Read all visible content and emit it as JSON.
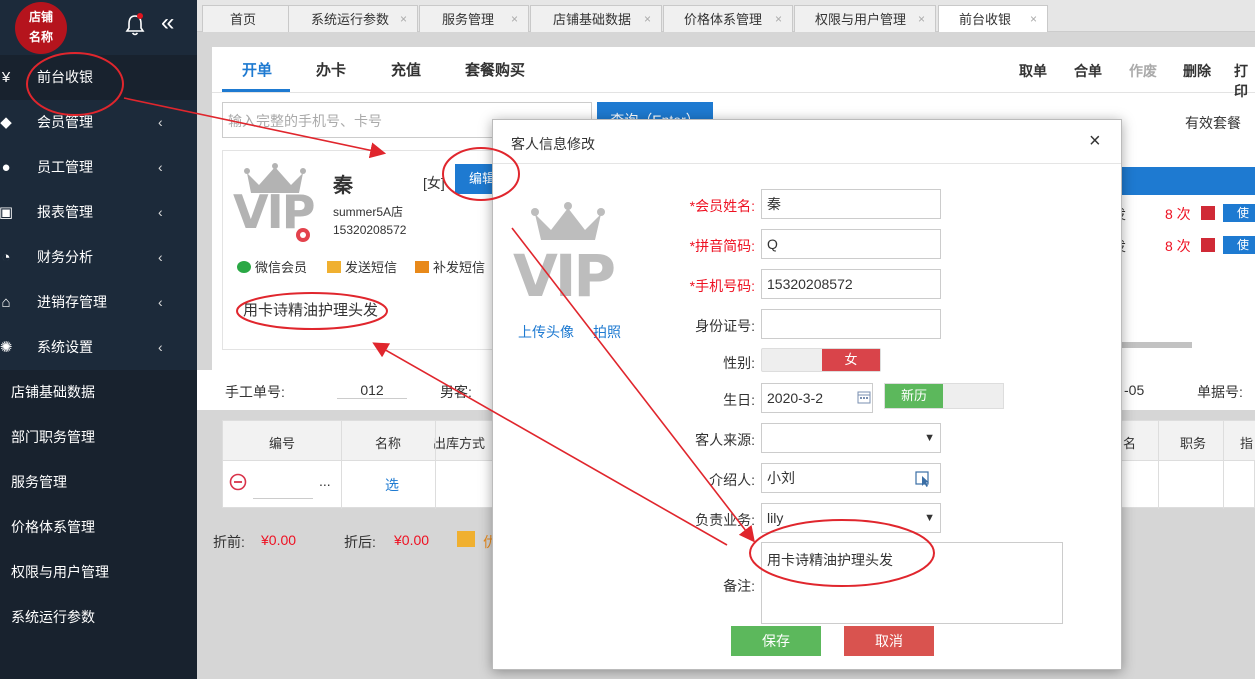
{
  "app": {
    "logo_text_line1": "店铺",
    "logo_text_line2": "名称",
    "collapse_glyph": "«",
    "colors": {
      "sidebar": "#1c2a3a",
      "accent": "#1e7ad1",
      "danger": "#d9534f",
      "success": "#5cb85c",
      "brand_red": "#b5141d"
    }
  },
  "sidebar": {
    "items": [
      {
        "label": "前台收银",
        "icon": "yen-icon",
        "glyph": "¥",
        "chevron": ""
      },
      {
        "label": "会员管理",
        "icon": "diamond-icon",
        "glyph": "◆",
        "chevron": "‹"
      },
      {
        "label": "员工管理",
        "icon": "user-icon",
        "glyph": "●",
        "chevron": "‹"
      },
      {
        "label": "报表管理",
        "icon": "report-icon",
        "glyph": "▣",
        "chevron": "‹"
      },
      {
        "label": "财务分析",
        "icon": "pie-icon",
        "glyph": "◔",
        "chevron": "‹"
      },
      {
        "label": "进销存管理",
        "icon": "home-icon",
        "glyph": "⌂",
        "chevron": "‹"
      },
      {
        "label": "系统设置",
        "icon": "gear-icon",
        "glyph": "✺",
        "chevron": "‹"
      }
    ],
    "sub_items": [
      "店铺基础数据",
      "部门职务管理",
      "服务管理",
      "价格体系管理",
      "权限与用户管理",
      "系统运行参数"
    ]
  },
  "tabs": [
    {
      "label": "首页",
      "close": ""
    },
    {
      "label": "系统运行参数",
      "close": "×"
    },
    {
      "label": "服务管理",
      "close": "×"
    },
    {
      "label": "店铺基础数据",
      "close": "×"
    },
    {
      "label": "价格体系管理",
      "close": "×"
    },
    {
      "label": "权限与用户管理",
      "close": "×"
    },
    {
      "label": "前台收银",
      "close": "×"
    }
  ],
  "pos": {
    "tabs": [
      "开单",
      "办卡",
      "充值",
      "套餐购买"
    ],
    "actions": [
      "取单",
      "合单",
      "作废",
      "删除",
      "打印"
    ],
    "search_placeholder": "输入完整的手机号、卡号",
    "search_button": "查询（Enter）",
    "valid_packages": "有效套餐",
    "member": {
      "name": "秦",
      "sex": "[女]",
      "edit": "编辑",
      "store": "summer5A店",
      "phone": "15320208572",
      "links": [
        "微信会员",
        "发送短信",
        "补发短信"
      ],
      "note": "用卡诗精油护理头发"
    },
    "package_rows": [
      {
        "partial": "发",
        "count": "8 次",
        "use": "使"
      },
      {
        "partial": "发",
        "count": "8 次",
        "use": "使"
      }
    ],
    "order": {
      "manual_no_label": "手工单号:",
      "manual_no": "012",
      "guest_label": "男客:",
      "date_partial": "-05",
      "doc_no_label": "单据号:"
    },
    "grid_headers": [
      "编号",
      "名称",
      "出库方式",
      "名",
      "职务",
      "指"
    ],
    "grid_row": {
      "dots": "...",
      "pick": "选"
    },
    "totals": {
      "before_label": "折前:",
      "before_value": "¥0.00",
      "after_label": "折后:",
      "after_value": "¥0.00",
      "coupon_partial": "优"
    }
  },
  "modal": {
    "title": "客人信息修改",
    "close": "×",
    "upload": "上传头像",
    "photo": "拍照",
    "fields": {
      "name_label": "*会员姓名:",
      "name": "秦",
      "pinyin_label": "*拼音简码:",
      "pinyin": "Q",
      "phone_label": "*手机号码:",
      "phone": "15320208572",
      "id_label": "身份证号:",
      "id": "",
      "sex_label": "性别:",
      "sex": "女",
      "birthday_label": "生日:",
      "birthday": "2020-3-2",
      "calendar_type": "新历",
      "source_label": "客人来源:",
      "source": "",
      "referrer_label": "介绍人:",
      "referrer": "小刘",
      "staff_label": "负责业务:",
      "staff": "lily",
      "note_label": "备注:",
      "note": "用卡诗精油护理头发"
    },
    "save": "保存",
    "cancel": "取消"
  },
  "vip_text": "VIP"
}
